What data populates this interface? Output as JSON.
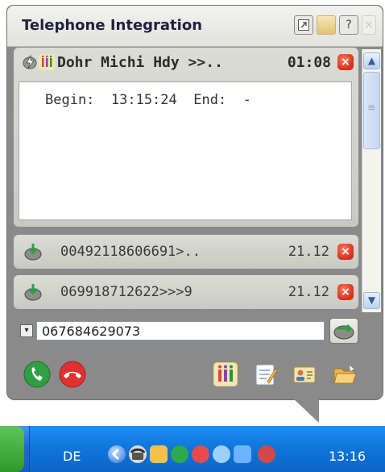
{
  "window": {
    "title": "Telephone Integration",
    "title_buttons": [
      "restore-icon",
      "pin-icon",
      "help-icon",
      "close-icon"
    ],
    "help_glyph": "?",
    "close_glyph": "×"
  },
  "active_call": {
    "title": "Dohr Michi Hdy >>..",
    "duration": "01:08",
    "detail_text": "Begin:  13:15:24  End:  -",
    "close_glyph": "×"
  },
  "call_list": [
    {
      "number": "00492118606691>..",
      "date": "21.12",
      "close_glyph": "×"
    },
    {
      "number": "069918712622>>>9",
      "date": "21.12",
      "close_glyph": "×"
    }
  ],
  "dial": {
    "value": "067684629073",
    "dropdown_glyph": "▾"
  },
  "scrollbar": {
    "up_glyph": "▲",
    "down_glyph": "▼",
    "grip_glyph": "≡"
  },
  "taskbar": {
    "language": "DE",
    "clock": "13:16"
  },
  "colors": {
    "accept_call": "#2f9e44",
    "hangup_call": "#e03131",
    "close_red": "#d3301a",
    "taskbar_blue": "#1f67d8"
  }
}
